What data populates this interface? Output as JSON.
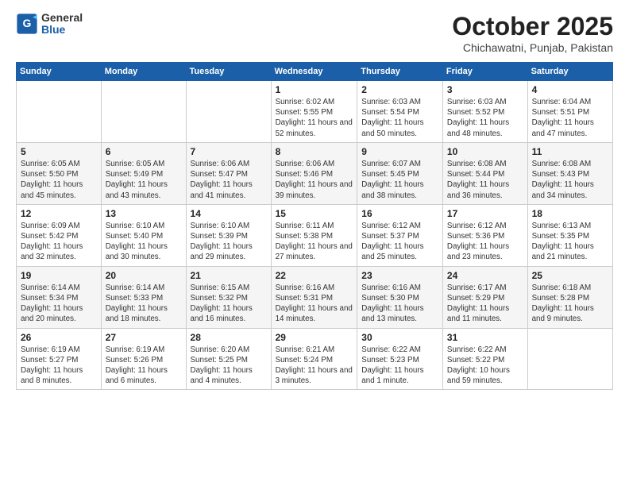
{
  "header": {
    "logo": {
      "general": "General",
      "blue": "Blue"
    },
    "title": "October 2025",
    "subtitle": "Chichawatni, Punjab, Pakistan"
  },
  "calendar": {
    "weekdays": [
      "Sunday",
      "Monday",
      "Tuesday",
      "Wednesday",
      "Thursday",
      "Friday",
      "Saturday"
    ],
    "weeks": [
      [
        {
          "day": "",
          "info": ""
        },
        {
          "day": "",
          "info": ""
        },
        {
          "day": "",
          "info": ""
        },
        {
          "day": "1",
          "info": "Sunrise: 6:02 AM\nSunset: 5:55 PM\nDaylight: 11 hours and 52 minutes."
        },
        {
          "day": "2",
          "info": "Sunrise: 6:03 AM\nSunset: 5:54 PM\nDaylight: 11 hours and 50 minutes."
        },
        {
          "day": "3",
          "info": "Sunrise: 6:03 AM\nSunset: 5:52 PM\nDaylight: 11 hours and 48 minutes."
        },
        {
          "day": "4",
          "info": "Sunrise: 6:04 AM\nSunset: 5:51 PM\nDaylight: 11 hours and 47 minutes."
        }
      ],
      [
        {
          "day": "5",
          "info": "Sunrise: 6:05 AM\nSunset: 5:50 PM\nDaylight: 11 hours and 45 minutes."
        },
        {
          "day": "6",
          "info": "Sunrise: 6:05 AM\nSunset: 5:49 PM\nDaylight: 11 hours and 43 minutes."
        },
        {
          "day": "7",
          "info": "Sunrise: 6:06 AM\nSunset: 5:47 PM\nDaylight: 11 hours and 41 minutes."
        },
        {
          "day": "8",
          "info": "Sunrise: 6:06 AM\nSunset: 5:46 PM\nDaylight: 11 hours and 39 minutes."
        },
        {
          "day": "9",
          "info": "Sunrise: 6:07 AM\nSunset: 5:45 PM\nDaylight: 11 hours and 38 minutes."
        },
        {
          "day": "10",
          "info": "Sunrise: 6:08 AM\nSunset: 5:44 PM\nDaylight: 11 hours and 36 minutes."
        },
        {
          "day": "11",
          "info": "Sunrise: 6:08 AM\nSunset: 5:43 PM\nDaylight: 11 hours and 34 minutes."
        }
      ],
      [
        {
          "day": "12",
          "info": "Sunrise: 6:09 AM\nSunset: 5:42 PM\nDaylight: 11 hours and 32 minutes."
        },
        {
          "day": "13",
          "info": "Sunrise: 6:10 AM\nSunset: 5:40 PM\nDaylight: 11 hours and 30 minutes."
        },
        {
          "day": "14",
          "info": "Sunrise: 6:10 AM\nSunset: 5:39 PM\nDaylight: 11 hours and 29 minutes."
        },
        {
          "day": "15",
          "info": "Sunrise: 6:11 AM\nSunset: 5:38 PM\nDaylight: 11 hours and 27 minutes."
        },
        {
          "day": "16",
          "info": "Sunrise: 6:12 AM\nSunset: 5:37 PM\nDaylight: 11 hours and 25 minutes."
        },
        {
          "day": "17",
          "info": "Sunrise: 6:12 AM\nSunset: 5:36 PM\nDaylight: 11 hours and 23 minutes."
        },
        {
          "day": "18",
          "info": "Sunrise: 6:13 AM\nSunset: 5:35 PM\nDaylight: 11 hours and 21 minutes."
        }
      ],
      [
        {
          "day": "19",
          "info": "Sunrise: 6:14 AM\nSunset: 5:34 PM\nDaylight: 11 hours and 20 minutes."
        },
        {
          "day": "20",
          "info": "Sunrise: 6:14 AM\nSunset: 5:33 PM\nDaylight: 11 hours and 18 minutes."
        },
        {
          "day": "21",
          "info": "Sunrise: 6:15 AM\nSunset: 5:32 PM\nDaylight: 11 hours and 16 minutes."
        },
        {
          "day": "22",
          "info": "Sunrise: 6:16 AM\nSunset: 5:31 PM\nDaylight: 11 hours and 14 minutes."
        },
        {
          "day": "23",
          "info": "Sunrise: 6:16 AM\nSunset: 5:30 PM\nDaylight: 11 hours and 13 minutes."
        },
        {
          "day": "24",
          "info": "Sunrise: 6:17 AM\nSunset: 5:29 PM\nDaylight: 11 hours and 11 minutes."
        },
        {
          "day": "25",
          "info": "Sunrise: 6:18 AM\nSunset: 5:28 PM\nDaylight: 11 hours and 9 minutes."
        }
      ],
      [
        {
          "day": "26",
          "info": "Sunrise: 6:19 AM\nSunset: 5:27 PM\nDaylight: 11 hours and 8 minutes."
        },
        {
          "day": "27",
          "info": "Sunrise: 6:19 AM\nSunset: 5:26 PM\nDaylight: 11 hours and 6 minutes."
        },
        {
          "day": "28",
          "info": "Sunrise: 6:20 AM\nSunset: 5:25 PM\nDaylight: 11 hours and 4 minutes."
        },
        {
          "day": "29",
          "info": "Sunrise: 6:21 AM\nSunset: 5:24 PM\nDaylight: 11 hours and 3 minutes."
        },
        {
          "day": "30",
          "info": "Sunrise: 6:22 AM\nSunset: 5:23 PM\nDaylight: 11 hours and 1 minute."
        },
        {
          "day": "31",
          "info": "Sunrise: 6:22 AM\nSunset: 5:22 PM\nDaylight: 10 hours and 59 minutes."
        },
        {
          "day": "",
          "info": ""
        }
      ]
    ]
  }
}
